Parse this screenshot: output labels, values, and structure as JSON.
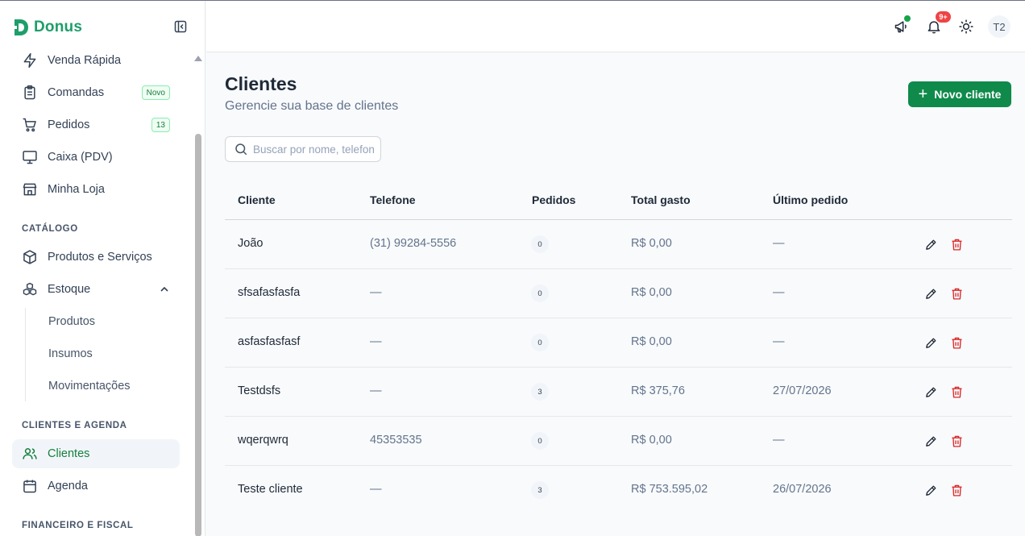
{
  "brand": {
    "name": "Donus",
    "color": "#1e9e6a"
  },
  "sidebar": {
    "items_top": [
      {
        "label": "Venda Rápida",
        "icon": "lightning-icon"
      },
      {
        "label": "Comandas",
        "icon": "clipboard-icon",
        "badge": "Novo"
      },
      {
        "label": "Pedidos",
        "icon": "cart-icon",
        "badge": "13"
      },
      {
        "label": "Caixa (PDV)",
        "icon": "monitor-icon"
      },
      {
        "label": "Minha Loja",
        "icon": "store-icon"
      }
    ],
    "section_catalog": "CATÁLOGO",
    "items_catalog": [
      {
        "label": "Produtos e Serviços",
        "icon": "package-icon"
      },
      {
        "label": "Estoque",
        "icon": "boxes-icon",
        "expanded": true
      }
    ],
    "stock_sub": [
      "Produtos",
      "Insumos",
      "Movimentações"
    ],
    "section_clients": "CLIENTES E AGENDA",
    "items_clients": [
      {
        "label": "Clientes",
        "icon": "users-icon",
        "active": true
      },
      {
        "label": "Agenda",
        "icon": "calendar-icon"
      }
    ],
    "section_finance": "FINANCEIRO E FISCAL"
  },
  "header": {
    "notifications_badge": "9+",
    "avatar": "T2"
  },
  "page": {
    "title": "Clientes",
    "subtitle": "Gerencie sua base de clientes",
    "new_button": "Novo cliente",
    "search_placeholder": "Buscar por nome, telefone"
  },
  "table": {
    "columns": [
      "Cliente",
      "Telefone",
      "Pedidos",
      "Total gasto",
      "Último pedido"
    ],
    "rows": [
      {
        "cliente": "João",
        "telefone": "(31) 99284-5556",
        "pedidos": "0",
        "total": "R$ 0,00",
        "ultimo": "—"
      },
      {
        "cliente": "sfsafasfasfa",
        "telefone": "—",
        "pedidos": "0",
        "total": "R$ 0,00",
        "ultimo": "—"
      },
      {
        "cliente": "asfasfasfasf",
        "telefone": "—",
        "pedidos": "0",
        "total": "R$ 0,00",
        "ultimo": "—"
      },
      {
        "cliente": "Testdsfs",
        "telefone": "—",
        "pedidos": "3",
        "total": "R$ 375,76",
        "ultimo": "27/07/2026"
      },
      {
        "cliente": "wqerqwrq",
        "telefone": "45353535",
        "pedidos": "0",
        "total": "R$ 0,00",
        "ultimo": "—"
      },
      {
        "cliente": "Teste cliente",
        "telefone": "—",
        "pedidos": "3",
        "total": "R$ 753.595,02",
        "ultimo": "26/07/2026"
      }
    ]
  },
  "colors": {
    "accent": "#0f8a4b",
    "danger": "#dc2626",
    "badge": "#ef4444"
  }
}
